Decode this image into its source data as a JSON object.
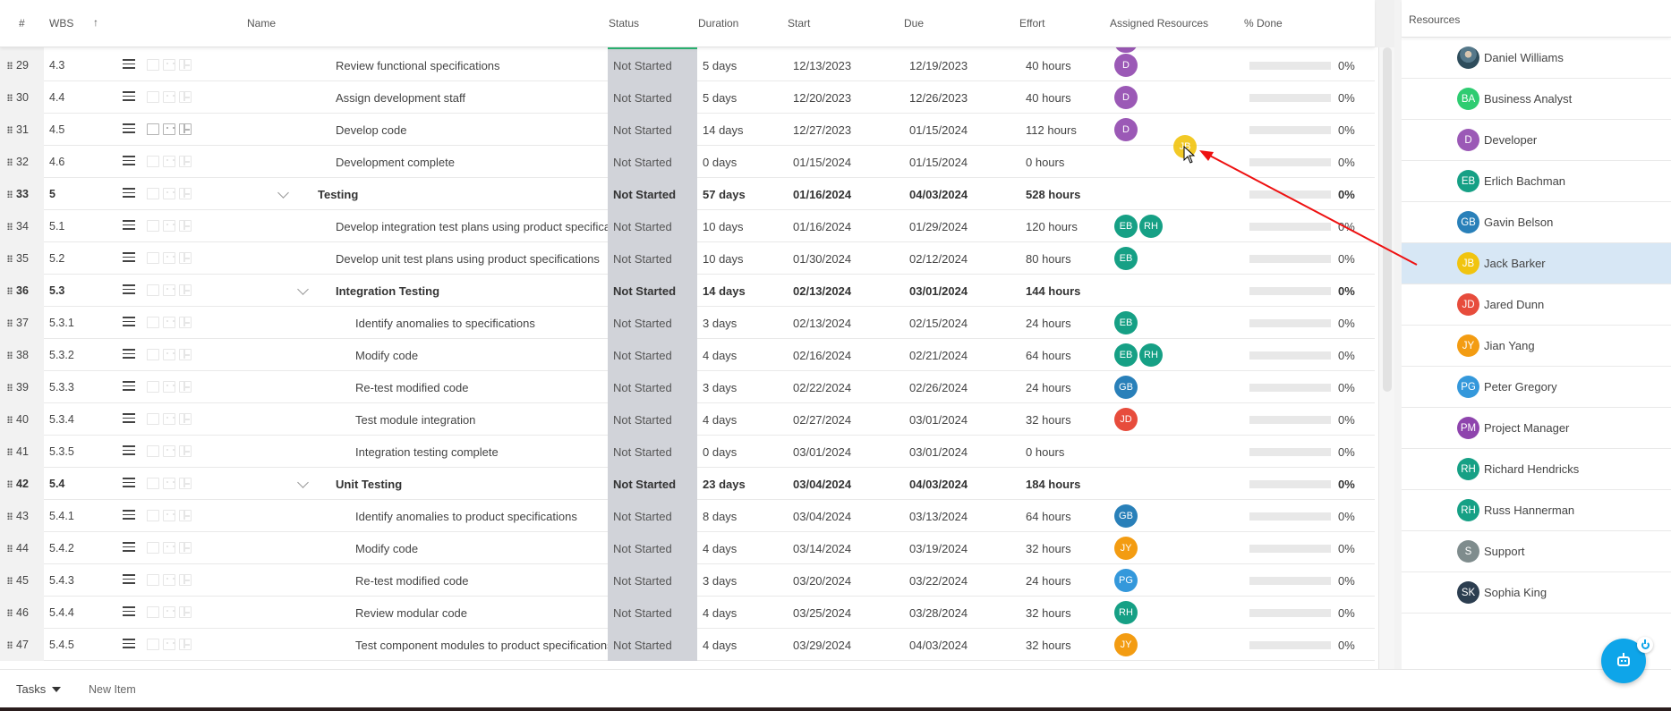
{
  "grid": {
    "columns": {
      "num": "#",
      "wbs": "WBS",
      "sort_indicator": "↑",
      "name": "Name",
      "status": "Status",
      "duration": "Duration",
      "start": "Start",
      "due": "Due",
      "effort": "Effort",
      "assigned": "Assigned Resources",
      "done": "% Done"
    },
    "rows": [
      {
        "num": "29",
        "wbs": "4.3",
        "name": "Review functional specifications",
        "level": 1,
        "bold": false,
        "status": "Not Started",
        "duration": "5 days",
        "start": "12/13/2023",
        "due": "12/19/2023",
        "effort": "40 hours",
        "resources": [
          "D"
        ],
        "done": "0%",
        "done_value": 0
      },
      {
        "num": "30",
        "wbs": "4.4",
        "name": "Assign development staff",
        "level": 1,
        "bold": false,
        "status": "Not Started",
        "duration": "5 days",
        "start": "12/20/2023",
        "due": "12/26/2023",
        "effort": "40 hours",
        "resources": [
          "D"
        ],
        "done": "0%",
        "done_value": 0
      },
      {
        "num": "31",
        "wbs": "4.5",
        "name": "Develop code",
        "level": 1,
        "bold": false,
        "status": "Not Started",
        "duration": "14 days",
        "start": "12/27/2023",
        "due": "01/15/2024",
        "effort": "112 hours",
        "resources": [
          "D"
        ],
        "done": "0%",
        "done_value": 0,
        "icons_visible": true
      },
      {
        "num": "32",
        "wbs": "4.6",
        "name": "Development complete",
        "level": 1,
        "bold": false,
        "status": "Not Started",
        "duration": "0 days",
        "start": "01/15/2024",
        "due": "01/15/2024",
        "effort": "0 hours",
        "resources": [],
        "done": "0%",
        "done_value": 0
      },
      {
        "num": "33",
        "wbs": "5",
        "name": "Testing",
        "level": 0,
        "bold": true,
        "expandable": true,
        "status": "Not Started",
        "duration": "57 days",
        "start": "01/16/2024",
        "due": "04/03/2024",
        "effort": "528 hours",
        "resources": [],
        "done": "0%",
        "done_value": 0
      },
      {
        "num": "34",
        "wbs": "5.1",
        "name": "Develop integration test plans using product specifications",
        "level": 1,
        "bold": false,
        "status": "Not Started",
        "duration": "10 days",
        "start": "01/16/2024",
        "due": "01/29/2024",
        "effort": "120 hours",
        "resources": [
          "EB",
          "RH"
        ],
        "done": "0%",
        "done_value": 0
      },
      {
        "num": "35",
        "wbs": "5.2",
        "name": "Develop unit test plans using product specifications",
        "level": 1,
        "bold": false,
        "status": "Not Started",
        "duration": "10 days",
        "start": "01/30/2024",
        "due": "02/12/2024",
        "effort": "80 hours",
        "resources": [
          "EB"
        ],
        "done": "0%",
        "done_value": 0
      },
      {
        "num": "36",
        "wbs": "5.3",
        "name": "Integration Testing",
        "level": 1,
        "bold": true,
        "expandable": true,
        "status": "Not Started",
        "duration": "14 days",
        "start": "02/13/2024",
        "due": "03/01/2024",
        "effort": "144 hours",
        "resources": [],
        "done": "0%",
        "done_value": 0
      },
      {
        "num": "37",
        "wbs": "5.3.1",
        "name": "Identify anomalies to specifications",
        "level": 2,
        "bold": false,
        "status": "Not Started",
        "duration": "3 days",
        "start": "02/13/2024",
        "due": "02/15/2024",
        "effort": "24 hours",
        "resources": [
          "EB"
        ],
        "done": "0%",
        "done_value": 0
      },
      {
        "num": "38",
        "wbs": "5.3.2",
        "name": "Modify code",
        "level": 2,
        "bold": false,
        "status": "Not Started",
        "duration": "4 days",
        "start": "02/16/2024",
        "due": "02/21/2024",
        "effort": "64 hours",
        "resources": [
          "EB",
          "RH"
        ],
        "done": "0%",
        "done_value": 0
      },
      {
        "num": "39",
        "wbs": "5.3.3",
        "name": "Re-test modified code",
        "level": 2,
        "bold": false,
        "status": "Not Started",
        "duration": "3 days",
        "start": "02/22/2024",
        "due": "02/26/2024",
        "effort": "24 hours",
        "resources": [
          "GB"
        ],
        "done": "0%",
        "done_value": 0
      },
      {
        "num": "40",
        "wbs": "5.3.4",
        "name": "Test module integration",
        "level": 2,
        "bold": false,
        "status": "Not Started",
        "duration": "4 days",
        "start": "02/27/2024",
        "due": "03/01/2024",
        "effort": "32 hours",
        "resources": [
          "JD"
        ],
        "done": "0%",
        "done_value": 0
      },
      {
        "num": "41",
        "wbs": "5.3.5",
        "name": "Integration testing complete",
        "level": 2,
        "bold": false,
        "status": "Not Started",
        "duration": "0 days",
        "start": "03/01/2024",
        "due": "03/01/2024",
        "effort": "0 hours",
        "resources": [],
        "done": "0%",
        "done_value": 0
      },
      {
        "num": "42",
        "wbs": "5.4",
        "name": "Unit Testing",
        "level": 1,
        "bold": true,
        "expandable": true,
        "status": "Not Started",
        "duration": "23 days",
        "start": "03/04/2024",
        "due": "04/03/2024",
        "effort": "184 hours",
        "resources": [],
        "done": "0%",
        "done_value": 0
      },
      {
        "num": "43",
        "wbs": "5.4.1",
        "name": "Identify anomalies to product specifications",
        "level": 2,
        "bold": false,
        "status": "Not Started",
        "duration": "8 days",
        "start": "03/04/2024",
        "due": "03/13/2024",
        "effort": "64 hours",
        "resources": [
          "GB"
        ],
        "done": "0%",
        "done_value": 0
      },
      {
        "num": "44",
        "wbs": "5.4.2",
        "name": "Modify code",
        "level": 2,
        "bold": false,
        "status": "Not Started",
        "duration": "4 days",
        "start": "03/14/2024",
        "due": "03/19/2024",
        "effort": "32 hours",
        "resources": [
          "JY"
        ],
        "done": "0%",
        "done_value": 0
      },
      {
        "num": "45",
        "wbs": "5.4.3",
        "name": "Re-test modified code",
        "level": 2,
        "bold": false,
        "status": "Not Started",
        "duration": "3 days",
        "start": "03/20/2024",
        "due": "03/22/2024",
        "effort": "24 hours",
        "resources": [
          "PG"
        ],
        "done": "0%",
        "done_value": 0
      },
      {
        "num": "46",
        "wbs": "5.4.4",
        "name": "Review modular code",
        "level": 2,
        "bold": false,
        "status": "Not Started",
        "duration": "4 days",
        "start": "03/25/2024",
        "due": "03/28/2024",
        "effort": "32 hours",
        "resources": [
          "RH"
        ],
        "done": "0%",
        "done_value": 0
      },
      {
        "num": "47",
        "wbs": "5.4.5",
        "name": "Test component modules to product specifications",
        "level": 2,
        "bold": false,
        "status": "Not Started",
        "duration": "4 days",
        "start": "03/29/2024",
        "due": "04/03/2024",
        "effort": "32 hours",
        "resources": [
          "JY"
        ],
        "done": "0%",
        "done_value": 0
      }
    ]
  },
  "avatar_colors": {
    "D": "#9b59b6",
    "EB": "#16a085",
    "RH": "#16a085",
    "GB": "#2980b9",
    "JD": "#e74c3c",
    "JY": "#f39c12",
    "PG": "#3498db",
    "JB": "#f1c40f",
    "BA": "#2ecc71",
    "PM": "#8e44ad",
    "S": "#7f8c8d",
    "SK": "#2c3e50"
  },
  "resources_panel": {
    "title": "Resources",
    "items": [
      {
        "initials": "",
        "name": "Daniel Williams",
        "photo": true
      },
      {
        "initials": "BA",
        "name": "Business Analyst"
      },
      {
        "initials": "D",
        "name": "Developer"
      },
      {
        "initials": "EB",
        "name": "Erlich Bachman"
      },
      {
        "initials": "GB",
        "name": "Gavin Belson"
      },
      {
        "initials": "JB",
        "name": "Jack Barker",
        "selected": true
      },
      {
        "initials": "JD",
        "name": "Jared Dunn"
      },
      {
        "initials": "JY",
        "name": "Jian Yang"
      },
      {
        "initials": "PG",
        "name": "Peter Gregory"
      },
      {
        "initials": "PM",
        "name": "Project Manager"
      },
      {
        "initials": "RH",
        "name": "Richard Hendricks"
      },
      {
        "initials": "RH",
        "name": "Russ Hannerman"
      },
      {
        "initials": "S",
        "name": "Support"
      },
      {
        "initials": "SK",
        "name": "Sophia King"
      }
    ]
  },
  "drag": {
    "avatar_initials": "JB",
    "source": "Jack Barker",
    "target_row": "31"
  },
  "footer": {
    "view_label": "Tasks",
    "new_item_label": "New Item"
  },
  "fab": {
    "icon": "bot-icon",
    "badge_icon": "power-icon"
  }
}
